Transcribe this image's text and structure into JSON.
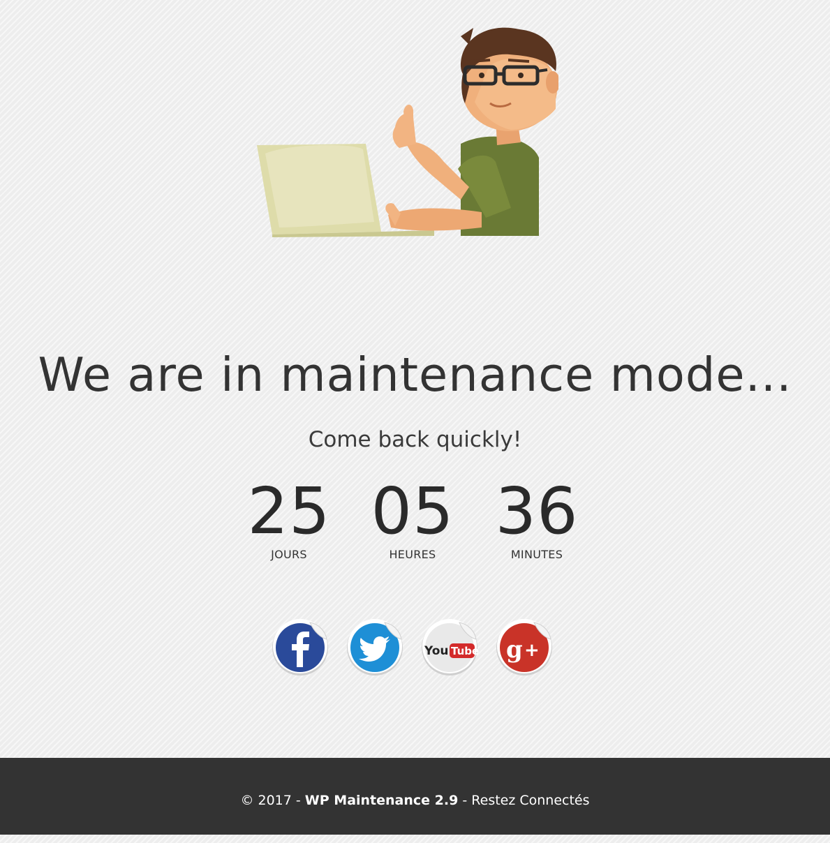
{
  "hero": {
    "illustration": "developer-thumbs-up-laptop-illustration"
  },
  "title": "We are in maintenance mode...",
  "subtitle": "Come back quickly!",
  "countdown": {
    "days": {
      "value": "25",
      "label": "JOURS"
    },
    "hours": {
      "value": "05",
      "label": "HEURES"
    },
    "minutes": {
      "value": "36",
      "label": "MINUTES"
    }
  },
  "social": [
    {
      "name": "facebook",
      "icon": "facebook-icon",
      "color": "#2a4a9a"
    },
    {
      "name": "twitter",
      "icon": "twitter-icon",
      "color": "#1e8fd6"
    },
    {
      "name": "youtube",
      "icon": "youtube-icon",
      "color": "#d32a2a"
    },
    {
      "name": "google-plus",
      "icon": "google-plus-icon",
      "color": "#c93328"
    }
  ],
  "footer": {
    "copyright": "© 2017 -",
    "brand": "WP Maintenance 2.9",
    "separator": "-",
    "link": "Restez Connectés"
  }
}
